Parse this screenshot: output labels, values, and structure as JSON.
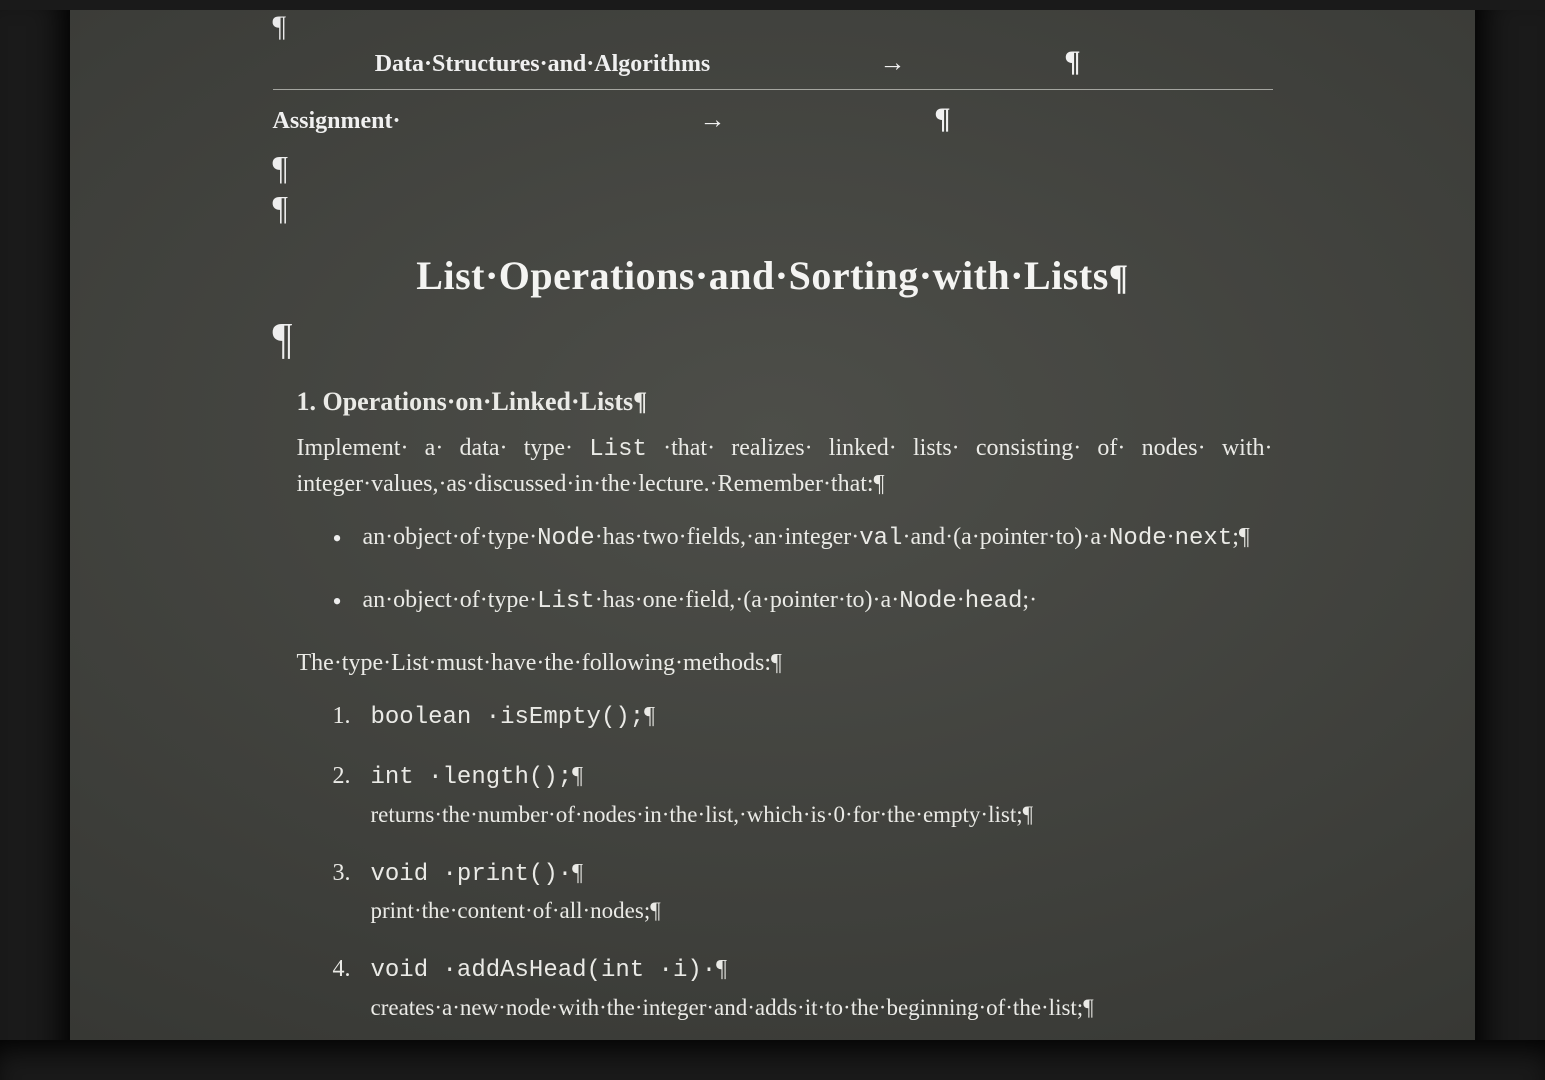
{
  "symbols": {
    "pilcrow": "¶",
    "middot": "·",
    "tab_arrow": "→"
  },
  "header": {
    "course_name": "Data·Structures·and·Algorithms",
    "assignment_label": "Assignment·"
  },
  "title": "List·Operations·and·Sorting·with·Lists",
  "section1": {
    "number_label": "1.",
    "heading": "Operations·on·Linked·Lists",
    "intro_pre": "Implement· a· data· type· ",
    "intro_code": "List",
    "intro_post": " ·that· realizes· linked· lists· consisting· of· nodes· with· integer·values,·as·discussed·in·the·lecture.·Remember·that:",
    "bullet1": {
      "t1": "an·object·of·type·",
      "c1": "Node",
      "t2": "·has·two·fields,·an·integer·",
      "c2": "val",
      "t3": "·and·(a·pointer·to)·a·",
      "c3": "Node",
      "t4": "·",
      "c4": "next",
      "t5": ";"
    },
    "bullet2": {
      "t1": "an·object·of·type·",
      "c1": "List",
      "t2": "·has·one·field,·(a·pointer·to)·a·",
      "c2": "Node",
      "t3": "·",
      "c3": "head",
      "t4": ";·"
    },
    "methods_intro": "The·type·List·must·have·the·following·methods:",
    "methods": [
      {
        "sig": "boolean ·isEmpty();",
        "desc": ""
      },
      {
        "sig": "int ·length();",
        "desc": "returns·the·number·of·nodes·in·the·list,·which·is·0·for·the·empty·list;"
      },
      {
        "sig": "void ·print()·",
        "desc": "print·the·content·of·all·nodes;"
      },
      {
        "sig": "void ·addAsHead(int ·i)·",
        "desc": "creates·a·new·node·with·the·integer·and·adds·it·to·the·beginning·of·the·list;"
      }
    ]
  }
}
